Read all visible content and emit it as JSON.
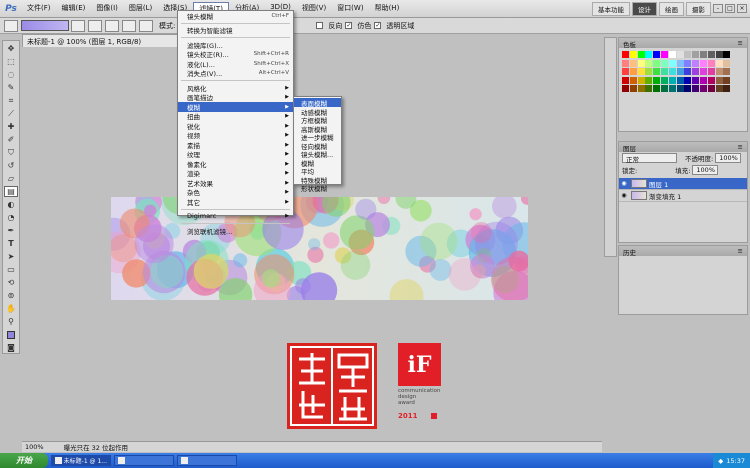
{
  "app": {
    "logo": "Ps"
  },
  "menubar": {
    "items": [
      "文件(F)",
      "编辑(E)",
      "图像(I)",
      "图层(L)",
      "选择(S)",
      "滤镜(T)",
      "分析(A)",
      "3D(D)",
      "视图(V)",
      "窗口(W)",
      "帮助(H)"
    ],
    "active_index": 5,
    "workspace": [
      "基本功能",
      "设计",
      "绘画",
      "摄影"
    ],
    "workspace_active": 1
  },
  "optionsbar": {
    "mode_label": "模式:",
    "checks": [
      "反向",
      "仿色",
      "透明区域"
    ]
  },
  "document": {
    "tab_title": "未标题-1 @ 100% (图层 1, RGB/8)",
    "zoom": "100%",
    "status": "曝光只在 32 位起作用"
  },
  "filter_menu": {
    "items": [
      {
        "label": "镜头模糊",
        "shortcut": "Ctrl+F",
        "arrow": false
      },
      {
        "sep": true
      },
      {
        "label": "转换为智能滤镜",
        "shortcut": "",
        "arrow": false
      },
      {
        "sep": true
      },
      {
        "label": "滤镜库(G)...",
        "shortcut": "",
        "arrow": false
      },
      {
        "label": "镜头校正(R)...",
        "shortcut": "Shift+Ctrl+R",
        "arrow": false
      },
      {
        "label": "液化(L)...",
        "shortcut": "Shift+Ctrl+X",
        "arrow": false
      },
      {
        "label": "消失点(V)...",
        "shortcut": "Alt+Ctrl+V",
        "arrow": false
      },
      {
        "sep": true
      },
      {
        "label": "风格化",
        "shortcut": "",
        "arrow": true
      },
      {
        "label": "画笔描边",
        "shortcut": "",
        "arrow": true
      },
      {
        "label": "模糊",
        "shortcut": "",
        "arrow": true,
        "highlight": true
      },
      {
        "label": "扭曲",
        "shortcut": "",
        "arrow": true
      },
      {
        "label": "锐化",
        "shortcut": "",
        "arrow": true
      },
      {
        "label": "视频",
        "shortcut": "",
        "arrow": true
      },
      {
        "label": "素描",
        "shortcut": "",
        "arrow": true
      },
      {
        "label": "纹理",
        "shortcut": "",
        "arrow": true
      },
      {
        "label": "像素化",
        "shortcut": "",
        "arrow": true
      },
      {
        "label": "渲染",
        "shortcut": "",
        "arrow": true
      },
      {
        "label": "艺术效果",
        "shortcut": "",
        "arrow": true
      },
      {
        "label": "杂色",
        "shortcut": "",
        "arrow": true
      },
      {
        "label": "其它",
        "shortcut": "",
        "arrow": true
      },
      {
        "sep": true
      },
      {
        "label": "Digimarc",
        "shortcut": "",
        "arrow": true
      },
      {
        "sep": true
      },
      {
        "label": "浏览联机滤镜...",
        "shortcut": "",
        "arrow": false
      }
    ]
  },
  "blur_submenu": {
    "items": [
      "表面模糊",
      "动感模糊",
      "方框模糊",
      "高斯模糊",
      "进一步模糊",
      "径向模糊",
      "镜头模糊...",
      "模糊",
      "平均",
      "特殊模糊",
      "形状模糊"
    ],
    "highlight_index": 0
  },
  "swatches": {
    "title": "色板",
    "colors": [
      "#ff0000",
      "#ffff00",
      "#00ff00",
      "#00ffff",
      "#0000ff",
      "#ff00ff",
      "#ffffff",
      "#e0e0e0",
      "#c0c0c0",
      "#a0a0a0",
      "#808080",
      "#606060",
      "#404040",
      "#000000",
      "#ff7f7f",
      "#ffbf7f",
      "#ffff7f",
      "#bfff7f",
      "#7fff7f",
      "#7fffbf",
      "#7fffff",
      "#7fbfff",
      "#7f7fff",
      "#bf7fff",
      "#ff7fff",
      "#ff7fbf",
      "#ffdfbf",
      "#dfbf9f",
      "#ff3f3f",
      "#ff9f3f",
      "#ffdf3f",
      "#9fdf3f",
      "#3fdf3f",
      "#3fdf9f",
      "#3fdfdf",
      "#3f9fdf",
      "#3f3fdf",
      "#9f3fdf",
      "#df3fdf",
      "#df3f9f",
      "#c09070",
      "#a07050",
      "#d00000",
      "#d06000",
      "#d0b000",
      "#60b000",
      "#00b000",
      "#00b060",
      "#00b0b0",
      "#0060b0",
      "#0000b0",
      "#6000b0",
      "#b000b0",
      "#b00060",
      "#906040",
      "#704020",
      "#900000",
      "#904000",
      "#907000",
      "#407000",
      "#007000",
      "#007040",
      "#007070",
      "#004070",
      "#000070",
      "#400070",
      "#700070",
      "#700040",
      "#604020",
      "#402010"
    ]
  },
  "layers": {
    "title": "图层",
    "blend_mode": "正常",
    "opacity_label": "不透明度:",
    "opacity": "100%",
    "lock_label": "锁定:",
    "fill_label": "填充:",
    "fill": "100%",
    "items": [
      {
        "name": "图层 1",
        "selected": true
      },
      {
        "name": "渐变填充 1",
        "selected": false
      }
    ]
  },
  "history": {
    "title": "历史"
  },
  "logos": {
    "seal_text": "創意·表情",
    "if_mark": "iF",
    "if_lines": [
      "communication",
      "design",
      "award"
    ],
    "if_year": "2011"
  },
  "taskbar": {
    "start": "开始",
    "items": [
      "未标题-1 @ 1...",
      "",
      ""
    ],
    "tray_time": "15:37"
  }
}
